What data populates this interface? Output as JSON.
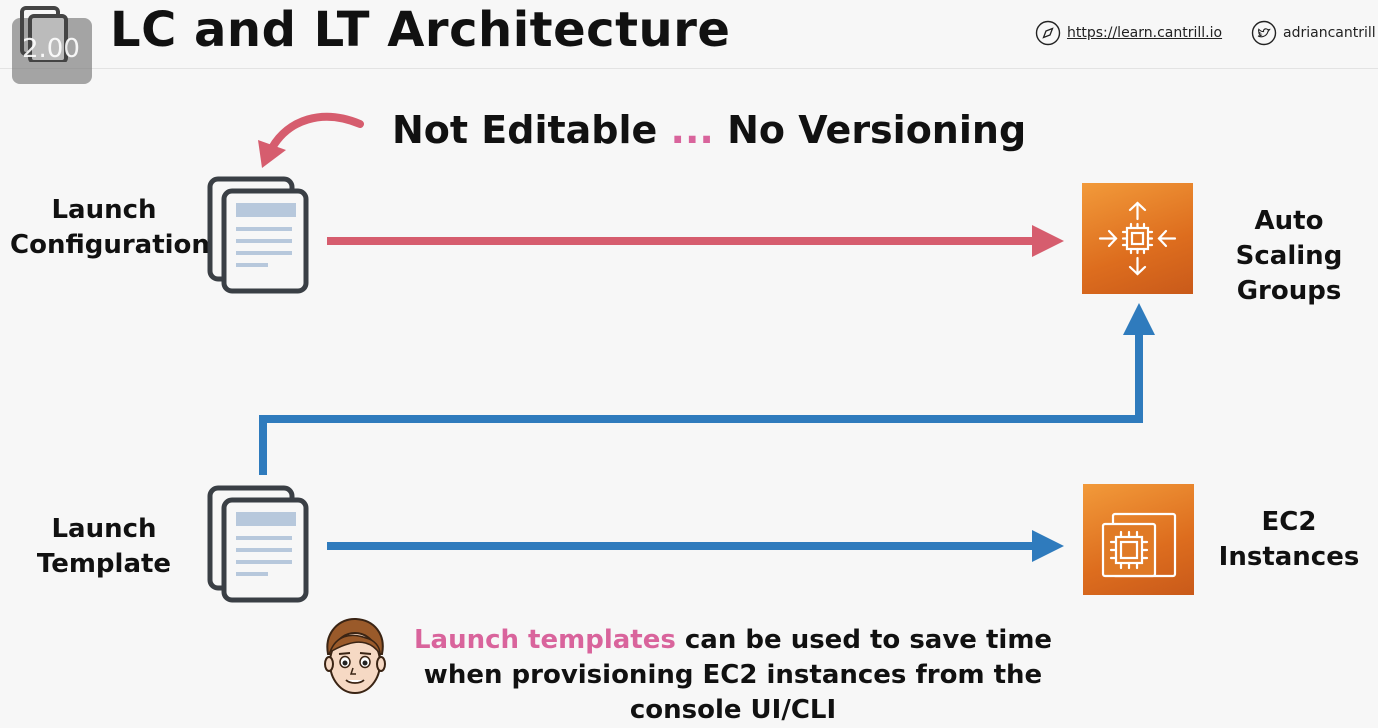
{
  "header": {
    "title": "LC and LT Architecture",
    "speed": "2.00",
    "website": "https://learn.cantrill.io",
    "twitter": "adriancantrill"
  },
  "diagram": {
    "note_left": "Not Editable",
    "note_dots": "...",
    "note_right": "No Versioning",
    "launch_configuration_label": "Launch Configuration",
    "launch_template_label": "Launch Template",
    "asg_label": "Auto Scaling Groups",
    "ec2_label": "EC2 Instances"
  },
  "footer": {
    "highlight": "Launch templates",
    "rest": " can be used to save time when provisioning EC2 instances from the console UI/CLI"
  },
  "colors": {
    "red_arrow": "#d65d6e",
    "blue_arrow": "#2f7bbd",
    "pink_accent": "#d9649c",
    "aws_orange": "#e47b26"
  },
  "icons": [
    "speed-docs-icon",
    "compass-icon",
    "twitter-icon",
    "document-icon",
    "auto-scaling-icon",
    "ec2-instances-icon",
    "avatar-face-icon"
  ]
}
